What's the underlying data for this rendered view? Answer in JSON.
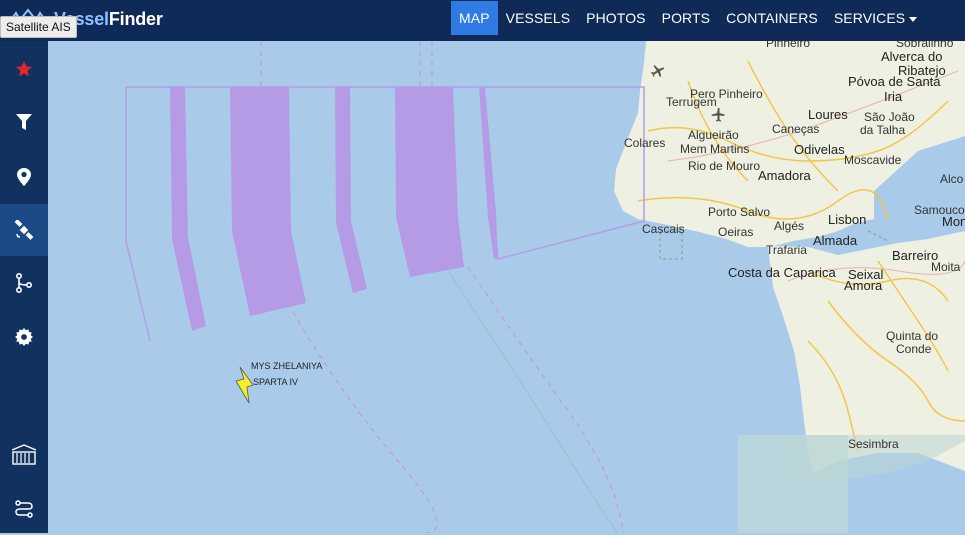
{
  "app": {
    "logo_prefix": "Vessel",
    "logo_suffix": "Finder",
    "tooltip": "Satellite AIS"
  },
  "nav": {
    "items": [
      {
        "label": "MAP",
        "active": true
      },
      {
        "label": "VESSELS",
        "active": false
      },
      {
        "label": "PHOTOS",
        "active": false
      },
      {
        "label": "PORTS",
        "active": false
      },
      {
        "label": "CONTAINERS",
        "active": false
      },
      {
        "label": "SERVICES",
        "active": false,
        "dropdown": true
      }
    ]
  },
  "sidebar": {
    "items": [
      {
        "icon": "star-icon",
        "color": "#e8232a"
      },
      {
        "icon": "filter-icon"
      },
      {
        "icon": "map-pin-icon"
      },
      {
        "icon": "satellite-icon",
        "active": true
      },
      {
        "icon": "route-icon"
      },
      {
        "icon": "gear-icon"
      },
      {
        "icon": "container-terminal-icon"
      },
      {
        "icon": "track-icon"
      }
    ]
  },
  "map": {
    "sea_color": "#a9cbe9",
    "land_color": "#eef0e2",
    "zone_color": "#b59be6",
    "vessel_color": "#f2ee2b",
    "vessels": [
      "MYS ZHELANIYA",
      "SPARTA IV"
    ],
    "places": [
      "Pinheiro",
      "Sobralinho",
      "Alverca do",
      "Ribatejo",
      "Póvoa de Santa",
      "Iria",
      "Pero Pinheiro",
      "Terrugem",
      "Loures",
      "São João",
      "da Talha",
      "Algueirão",
      "Mem Martins",
      "Caneças",
      "Colares",
      "Odivelas",
      "Moscavide",
      "Rio de Mouro",
      "Amadora",
      "Alco",
      "Porto Salvo",
      "Samouco",
      "Cascais",
      "Algés",
      "Lisbon",
      "Mont",
      "Oeiras",
      "Trafaria",
      "Almada",
      "Barreiro",
      "Costa da Caparica",
      "Seixal",
      "Moita",
      "Amora",
      "Quinta do",
      "Conde",
      "Sesimbra"
    ]
  }
}
